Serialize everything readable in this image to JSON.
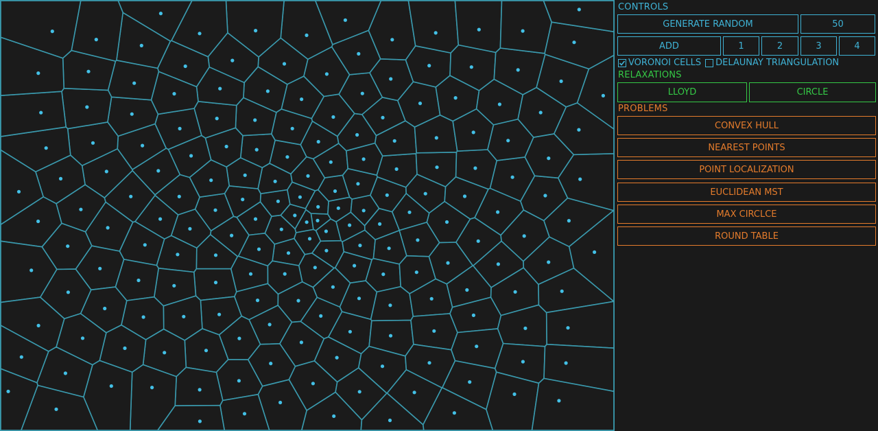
{
  "colors": {
    "background": "#1a1a1a",
    "cell_edge": "#3a9aae",
    "site_point": "#43c0e6",
    "controls_accent": "#3fb3d6",
    "relaxations_accent": "#35c946",
    "problems_accent": "#e57c2c"
  },
  "controls": {
    "title": "CONTROLS",
    "generate_label": "GENERATE RANDOM",
    "count_value": "50",
    "add_label": "ADD",
    "add_options": [
      "1",
      "2",
      "3",
      "4"
    ],
    "voronoi_label": "VORONOI CELLS",
    "voronoi_checked": true,
    "delaunay_label": "DELAUNAY TRIANGULATION",
    "delaunay_checked": false
  },
  "relaxations": {
    "title": "RELAXATIONS",
    "lloyd_label": "LLOYD",
    "circle_label": "CIRCLE"
  },
  "problems": {
    "title": "PROBLEMS",
    "items": [
      "CONVEX HULL",
      "NEAREST POINTS",
      "POINT LOCALIZATION",
      "EUCLIDEAN MST",
      "MAX CIRCLCE",
      "ROUND TABLE"
    ]
  },
  "icons": {
    "checkbox_checked": "checkmark-icon"
  }
}
